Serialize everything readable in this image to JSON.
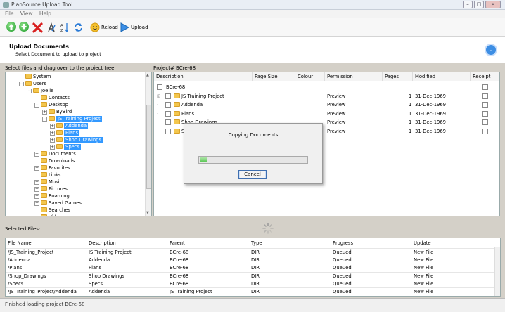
{
  "window": {
    "title": "PlanSource Upload Tool"
  },
  "menu": [
    "File",
    "View",
    "Help"
  ],
  "toolbar": {
    "reload_label": "Reload",
    "upload_label": "Upload"
  },
  "header": {
    "title": "Upload Documents",
    "subtitle": "Select Document to upload to project"
  },
  "left_panel": {
    "label": "Select files and drag over to the project tree",
    "tree": [
      {
        "label": "System",
        "depth": 1,
        "expander": "",
        "selected": false
      },
      {
        "label": "Users",
        "depth": 1,
        "expander": "-",
        "selected": false
      },
      {
        "label": "Joelle",
        "depth": 2,
        "expander": "-",
        "selected": false
      },
      {
        "label": "Contacts",
        "depth": 3,
        "expander": "",
        "selected": false
      },
      {
        "label": "Desktop",
        "depth": 3,
        "expander": "-",
        "selected": false
      },
      {
        "label": "ByBird",
        "depth": 4,
        "expander": "+",
        "selected": false
      },
      {
        "label": "JS Training Project",
        "depth": 4,
        "expander": "-",
        "selected": true
      },
      {
        "label": "Addenda",
        "depth": 5,
        "expander": "+",
        "selected": true
      },
      {
        "label": "Plans",
        "depth": 5,
        "expander": "+",
        "selected": true
      },
      {
        "label": "Shop Drawings",
        "depth": 5,
        "expander": "+",
        "selected": true
      },
      {
        "label": "Specs",
        "depth": 5,
        "expander": "+",
        "selected": true
      },
      {
        "label": "Documents",
        "depth": 3,
        "expander": "+",
        "selected": false
      },
      {
        "label": "Downloads",
        "depth": 3,
        "expander": "",
        "selected": false
      },
      {
        "label": "Favorites",
        "depth": 3,
        "expander": "+",
        "selected": false
      },
      {
        "label": "Links",
        "depth": 3,
        "expander": "",
        "selected": false
      },
      {
        "label": "Music",
        "depth": 3,
        "expander": "+",
        "selected": false
      },
      {
        "label": "Pictures",
        "depth": 3,
        "expander": "+",
        "selected": false
      },
      {
        "label": "Roaming",
        "depth": 3,
        "expander": "+",
        "selected": false
      },
      {
        "label": "Saved Games",
        "depth": 3,
        "expander": "+",
        "selected": false
      },
      {
        "label": "Searches",
        "depth": 3,
        "expander": "",
        "selected": false
      },
      {
        "label": "Videos",
        "depth": 3,
        "expander": "",
        "selected": false
      }
    ]
  },
  "project_panel": {
    "label": "Project# BCre-68",
    "columns": [
      "Description",
      "Page Size",
      "Colour",
      "Permission",
      "Pages",
      "Modified",
      "Receipt"
    ],
    "rows": [
      {
        "description": "BCre-68",
        "permission": "",
        "pages": "",
        "modified": ""
      },
      {
        "description": "JS Training Project",
        "permission": "Preview",
        "pages": "1",
        "modified": "31-Dec-1969"
      },
      {
        "description": "Addenda",
        "permission": "Preview",
        "pages": "1",
        "modified": "31-Dec-1969"
      },
      {
        "description": "Plans",
        "permission": "Preview",
        "pages": "1",
        "modified": "31-Dec-1969"
      },
      {
        "description": "Shop Drawings",
        "permission": "Preview",
        "pages": "1",
        "modified": "31-Dec-1969"
      },
      {
        "description": "Specs",
        "permission": "Preview",
        "pages": "1",
        "modified": "31-Dec-1969"
      }
    ]
  },
  "dialog": {
    "title": "Copying Documents",
    "cancel_label": "Cancel",
    "progress": 0.06
  },
  "selected_files": {
    "label": "Selected Files:",
    "columns": [
      "File Name",
      "Description",
      "Parent",
      "Type",
      "Progress",
      "Update"
    ],
    "rows": [
      [
        "/JS_Training_Project",
        "JS Training Project",
        "BCre-68",
        "DIR",
        "Queued",
        "New File"
      ],
      [
        "/Addenda",
        "Addenda",
        "BCre-68",
        "DIR",
        "Queued",
        "New File"
      ],
      [
        "/Plans",
        "Plans",
        "BCre-68",
        "DIR",
        "Queued",
        "New File"
      ],
      [
        "/Shop_Drawings",
        "Shop Drawings",
        "BCre-68",
        "DIR",
        "Queued",
        "New File"
      ],
      [
        "/Specs",
        "Specs",
        "BCre-68",
        "DIR",
        "Queued",
        "New File"
      ],
      [
        "/JS_Training_Project/Addenda",
        "Addenda",
        "JS Training Project",
        "DIR",
        "Queued",
        "New File"
      ]
    ]
  },
  "status": "Finished loading project BCre-68"
}
